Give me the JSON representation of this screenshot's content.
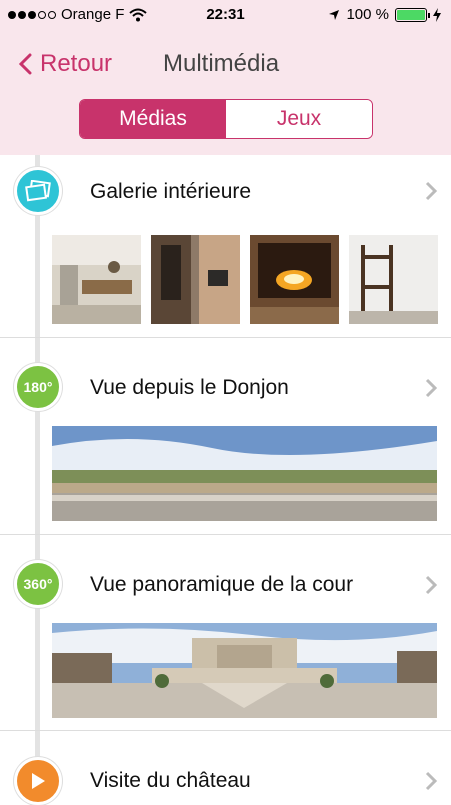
{
  "status": {
    "carrier": "Orange F",
    "time": "22:31",
    "battery": "100 %",
    "battery_level": 1.0
  },
  "nav": {
    "back_label": "Retour",
    "title": "Multimédia"
  },
  "tabs": [
    {
      "label": "Médias",
      "active": true
    },
    {
      "label": "Jeux",
      "active": false
    }
  ],
  "sections": [
    {
      "title": "Galerie intérieure",
      "badge": "gallery-icon",
      "badge_color": "#2ec4d6"
    },
    {
      "title": "Vue depuis le Donjon",
      "badge": "180°",
      "badge_color": "#7cc242"
    },
    {
      "title": "Vue panoramique de la cour",
      "badge": "360°",
      "badge_color": "#7cc242"
    },
    {
      "title": "Visite du château",
      "badge": "play-icon",
      "badge_color": "#f28b2c"
    }
  ],
  "colors": {
    "accent": "#c8336b",
    "nav_bg": "#f9e6ec"
  }
}
